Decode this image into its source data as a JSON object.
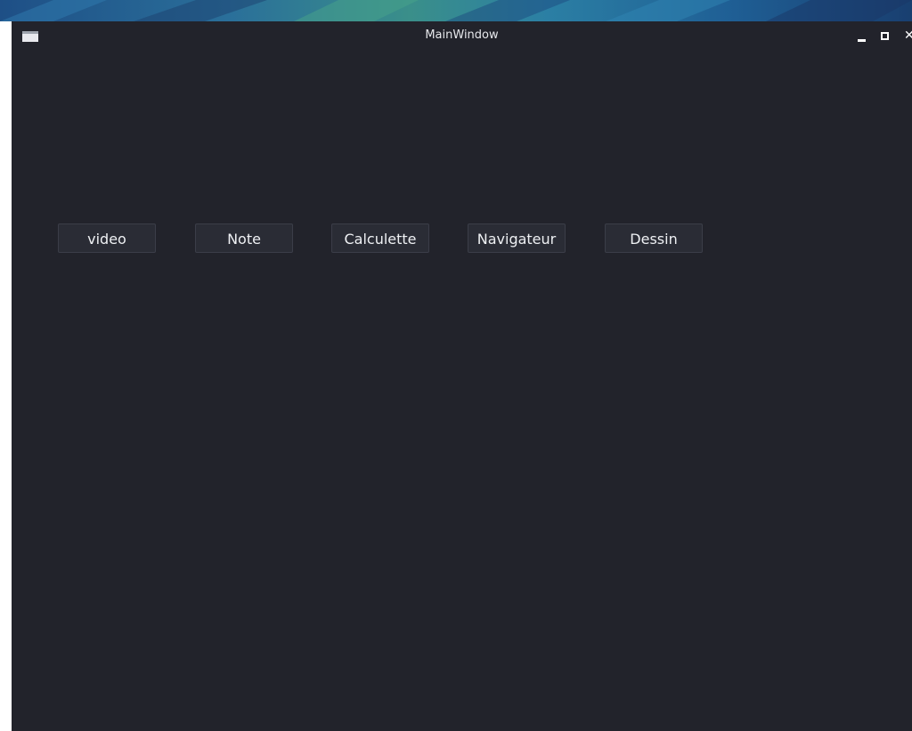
{
  "window": {
    "title": "MainWindow",
    "controls": {
      "minimize_icon": "minimize-icon",
      "maximize_icon": "maximize-icon",
      "close_icon": "close-icon",
      "close_glyph": "✕"
    },
    "app_icon": "window-icon"
  },
  "buttons": [
    {
      "label": "video"
    },
    {
      "label": "Note"
    },
    {
      "label": "Calculette"
    },
    {
      "label": "Navigateur"
    },
    {
      "label": "Dessin"
    }
  ],
  "colors": {
    "window_bg": "#22232b",
    "button_bg": "#2a2c35",
    "button_border": "#3b3d48",
    "text": "#eef0f3"
  }
}
